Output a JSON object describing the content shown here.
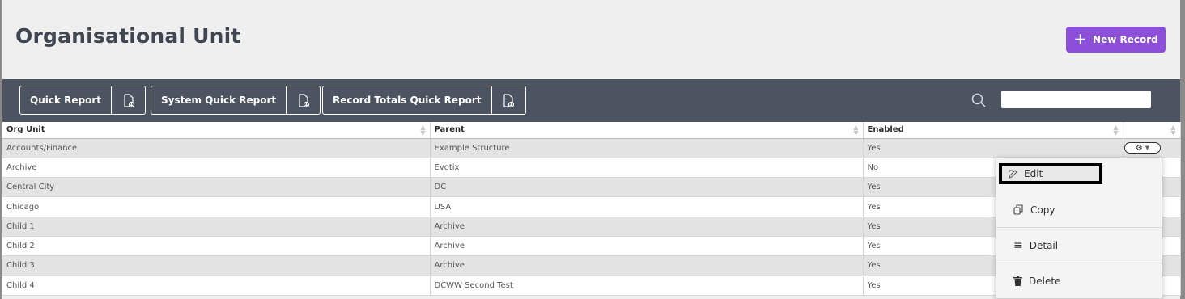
{
  "page": {
    "title": "Organisational Unit",
    "new_record_label": "New Record"
  },
  "toolbar": {
    "reports": [
      {
        "label": "Quick Report"
      },
      {
        "label": "System Quick Report"
      },
      {
        "label": "Record Totals Quick Report"
      }
    ],
    "search_value": ""
  },
  "table": {
    "columns": [
      "Org Unit",
      "Parent",
      "Enabled"
    ],
    "rows": [
      {
        "org_unit": "Accounts/Finance",
        "parent": "Example Structure",
        "enabled": "Yes"
      },
      {
        "org_unit": "Archive",
        "parent": "Evotix",
        "enabled": "No"
      },
      {
        "org_unit": "Central City",
        "parent": "DC",
        "enabled": "Yes"
      },
      {
        "org_unit": "Chicago",
        "parent": "USA",
        "enabled": "Yes"
      },
      {
        "org_unit": "Child 1",
        "parent": "Archive",
        "enabled": "Yes"
      },
      {
        "org_unit": "Child 2",
        "parent": "Archive",
        "enabled": "Yes"
      },
      {
        "org_unit": "Child 3",
        "parent": "Archive",
        "enabled": "Yes"
      },
      {
        "org_unit": "Child 4",
        "parent": "DCWW Second Test",
        "enabled": "Yes"
      }
    ]
  },
  "row_menu": {
    "items": [
      {
        "label": "Edit",
        "icon": "pencil-icon"
      },
      {
        "label": "Copy",
        "icon": "copy-icon"
      },
      {
        "label": "Detail",
        "icon": "list-icon"
      },
      {
        "label": "Delete",
        "icon": "trash-icon"
      }
    ]
  },
  "colors": {
    "accent": "#8b4fd8",
    "toolbar_bg": "#4d5461",
    "title": "#3f4651",
    "row_alt": "#e3e3e3"
  }
}
